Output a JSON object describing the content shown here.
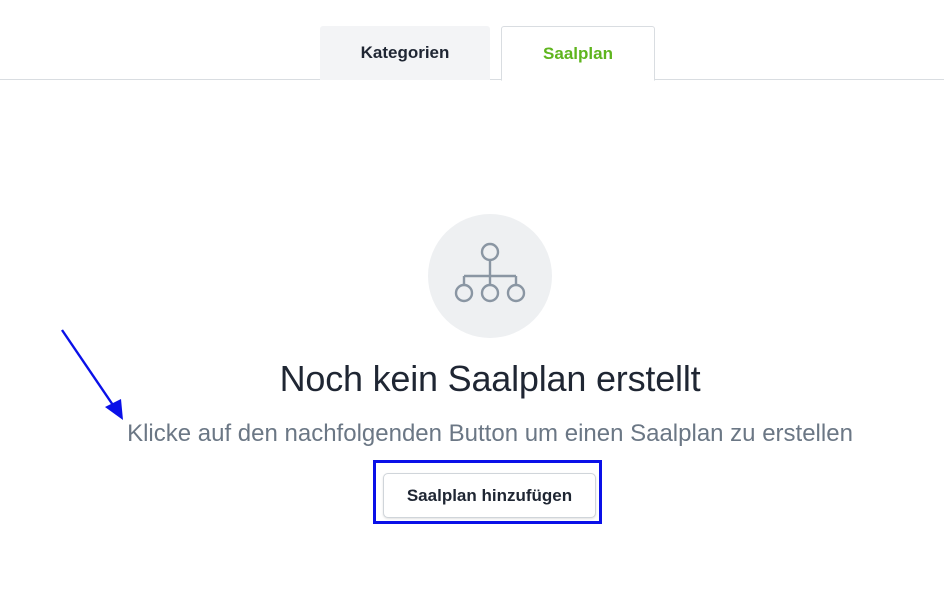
{
  "tabs": [
    {
      "label": "Kategorien",
      "active": false
    },
    {
      "label": "Saalplan",
      "active": true
    }
  ],
  "empty_state": {
    "icon": "hierarchy-icon",
    "title": "Noch kein Saalplan erstellt",
    "subtitle": "Klicke auf den nachfolgenden Button um einen Saalplan zu erstellen",
    "button_label": "Saalplan hinzufügen"
  },
  "colors": {
    "active_tab": "#5fb51e",
    "annotation": "#0a10e8",
    "icon_stroke": "#8a96a3"
  }
}
